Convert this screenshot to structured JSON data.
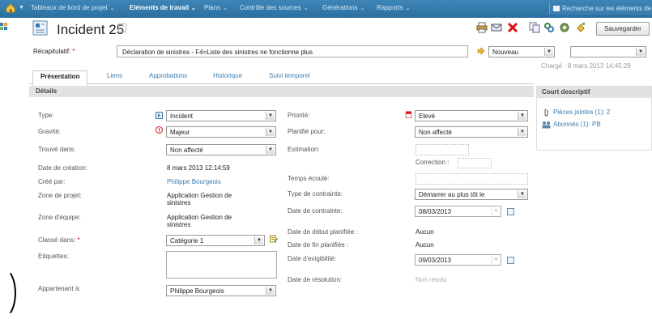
{
  "topnav": {
    "items": [
      {
        "label": "Tableaux de bord de projet",
        "bold": false
      },
      {
        "label": "Eléments de travail",
        "bold": true
      },
      {
        "label": "Plans",
        "bold": false
      },
      {
        "label": "Contrôle des sources",
        "bold": false
      },
      {
        "label": "Générations",
        "bold": false
      },
      {
        "label": "Rapports",
        "bold": false
      }
    ],
    "search_placeholder": "Recherche sur les éléments de Q"
  },
  "header": {
    "title": "Incident 25",
    "help": "?",
    "save_label": "Sauvegarder"
  },
  "summary": {
    "label": "Récapitulatif:",
    "required": "*",
    "value": "Déclaration de sinistres - F4=Liste des sinistres ne fonctionne plus",
    "state": "Nouveau",
    "loaded": "Chargé : 8 mars 2013 14:45:29"
  },
  "tabs": [
    "Présentation",
    "Liens",
    "Approbations",
    "Historique",
    "Suivi temporel"
  ],
  "section_title": "Détails",
  "left_fields": {
    "type_label": "Type:",
    "type_value": "Incident",
    "gravite_label": "Gravité:",
    "gravite_value": "Majeur",
    "trouve_label": "Trouvé dans:",
    "trouve_value": "Non affecté",
    "date_creation_label": "Date de création:",
    "date_creation_value": "8 mars 2013 12:14:59",
    "cree_label": "Créé par:",
    "cree_value": "Philippe Bourgeois",
    "zone_projet_label": "Zone de projet:",
    "zone_projet_value": "Application Gestion de sinistres",
    "zone_equipe_label": "Zone d'équipe:",
    "zone_equipe_value": "Application Gestion de sinistres",
    "classe_label": "Classé dans:",
    "classe_required": "*",
    "classe_value": "Catégorie 1",
    "etiquettes_label": "Etiquettes:",
    "appartenant_label": "Appartenant à:",
    "appartenant_value": "Philippe Bourgeois"
  },
  "right_fields": {
    "priorite_label": "Priorité:",
    "priorite_value": "Elevé",
    "planifie_label": "Planifié pour:",
    "planifie_value": "Non affecté",
    "estimation_label": "Estimation:",
    "correction_label": "Correction :",
    "temps_label": "Temps écoulé:",
    "type_contrainte_label": "Type de contrainte:",
    "type_contrainte_value": "Démarrer au plus tôt le",
    "date_contrainte_label": "Date de contrainte:",
    "date_contrainte_value": "08/03/2013",
    "debut_label": "Date de début planifiée :",
    "debut_value": "Aucun",
    "fin_label": "Date de fin planifiée :",
    "fin_value": "Aucun",
    "exigibilite_label": "Date d'exigibilité:",
    "exigibilite_value": "09/03/2013",
    "resolution_label": "Date de résolution:",
    "resolution_value": "Non résolu"
  },
  "side_panel": {
    "title": "Court descriptif",
    "attachments": "Pièces jointes (1): 2",
    "subscribers": "Abonnés (1): PB"
  },
  "caret": "▼"
}
